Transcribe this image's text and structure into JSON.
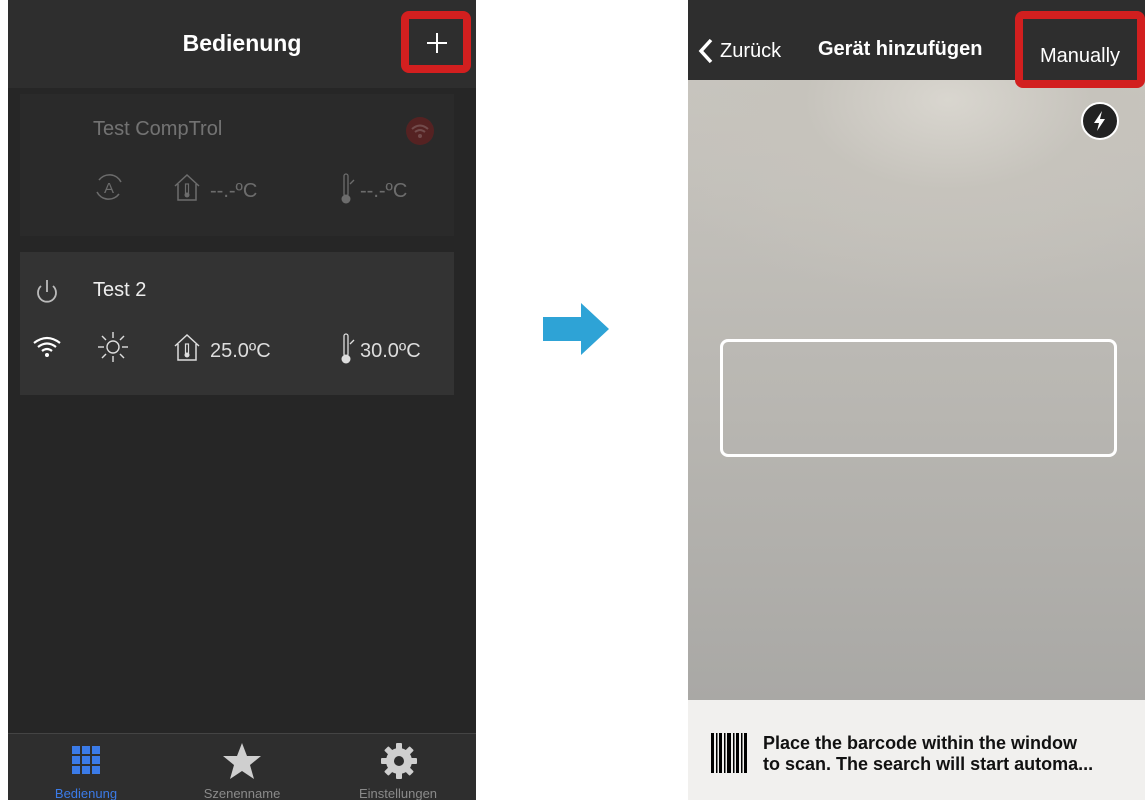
{
  "left": {
    "header_title": "Bedienung",
    "devices": [
      {
        "name": "Test CompTrol",
        "room_temp": "--.-ºC",
        "target_temp": "--.-ºC"
      },
      {
        "name": "Test 2",
        "room_temp": "25.0ºC",
        "target_temp": "30.0ºC"
      }
    ],
    "tabs": [
      {
        "label": "Bedienung"
      },
      {
        "label": "Szenenname"
      },
      {
        "label": "Einstellungen"
      }
    ]
  },
  "right": {
    "back_label": "Zurück",
    "title": "Gerät hinzufügen",
    "manual_label": "Manually",
    "instruction_line1": "Place the barcode within the window",
    "instruction_line2": "to scan. The search will start automa..."
  },
  "colors": {
    "highlight": "#d21f1f",
    "active_tab": "#3b7be8",
    "arrow": "#2ea3d6",
    "background_dark": "#262626",
    "card": "#333333"
  }
}
